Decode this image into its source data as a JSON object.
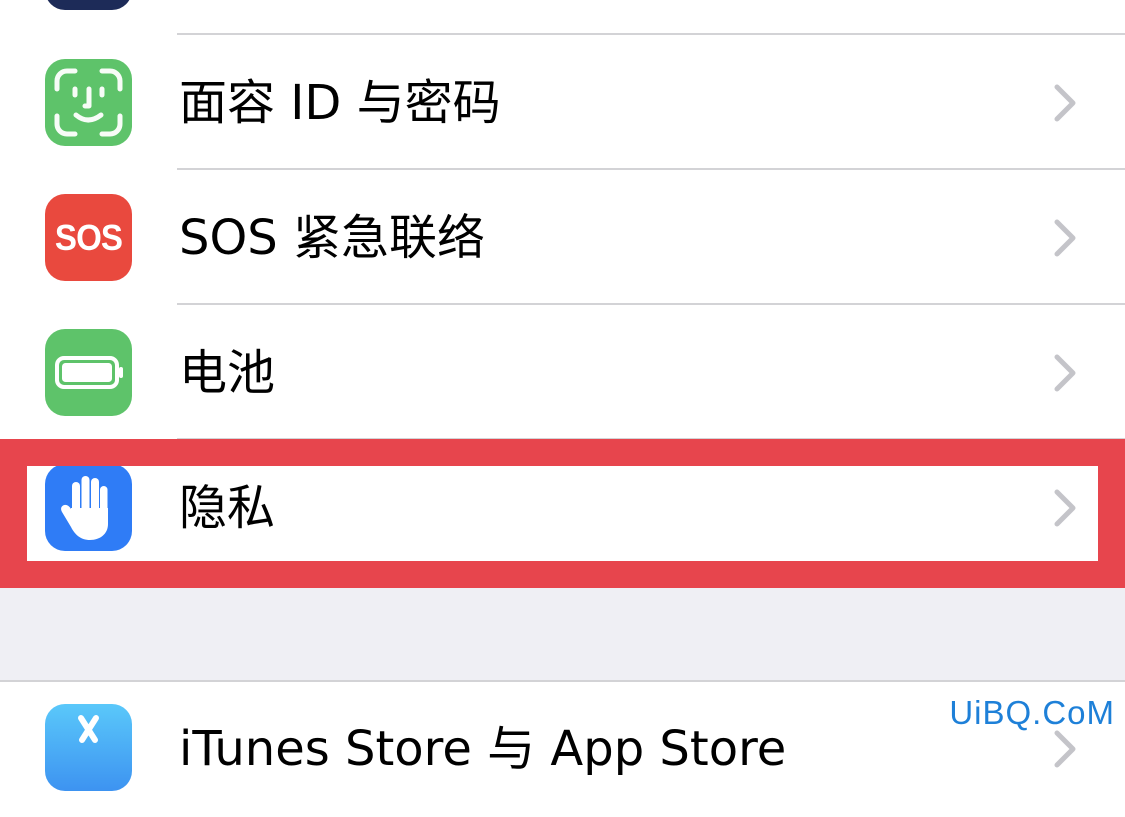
{
  "settings_list": {
    "items": [
      {
        "id": "face-id",
        "label": "面容 ID 与密码",
        "icon": "face-id-icon",
        "icon_color": "#5ec36a"
      },
      {
        "id": "sos",
        "label": "SOS 紧急联络",
        "icon": "sos-icon",
        "icon_text": "SOS",
        "icon_color": "#e9493e"
      },
      {
        "id": "battery",
        "label": "电池",
        "icon": "battery-icon",
        "icon_color": "#5ec36a"
      },
      {
        "id": "privacy",
        "label": "隐私",
        "icon": "privacy-hand-icon",
        "icon_color": "#2f7cf6",
        "highlighted": true
      }
    ],
    "next_section_item": {
      "id": "itunes-app-store",
      "label": "iTunes Store 与 App Store",
      "icon": "app-store-icon",
      "icon_color": "#3d93f1"
    }
  },
  "highlight_color": "#e7454d",
  "watermark": "UiBQ.CoM"
}
